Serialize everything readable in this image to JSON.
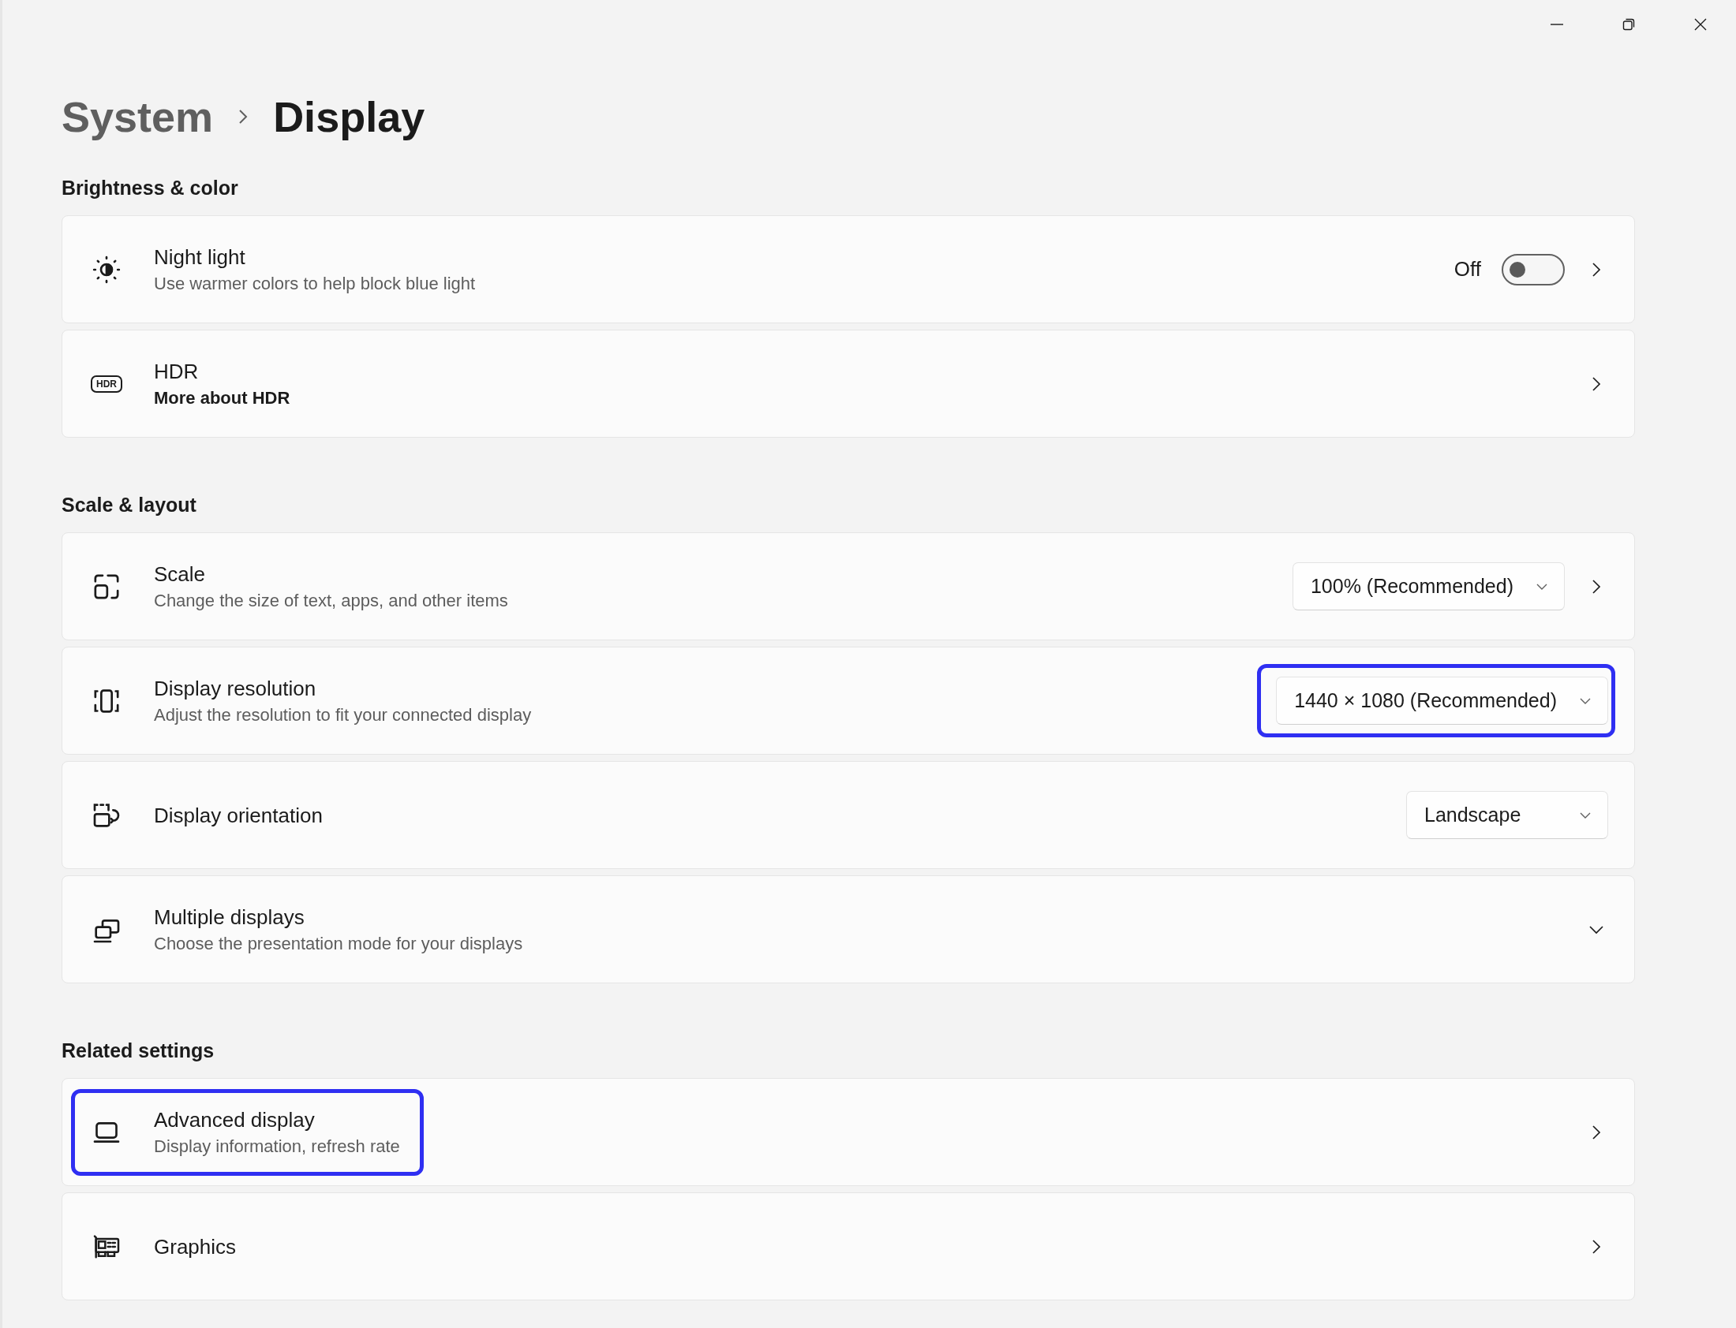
{
  "window": {
    "controls": [
      {
        "kind": "minimize"
      },
      {
        "kind": "restore"
      },
      {
        "kind": "close"
      }
    ]
  },
  "breadcrumb": {
    "parent": "System",
    "current": "Display"
  },
  "sections": [
    {
      "title": "Brightness & color",
      "items": [
        {
          "title": "Night light",
          "subtitle": "Use warmer colors to help block blue light",
          "control": {
            "kind": "toggle",
            "on": false,
            "state_label": "Off"
          },
          "kind": "navigation",
          "highlighted": false
        },
        {
          "title": "HDR",
          "badge": "HDR",
          "link": "More about HDR",
          "kind": "navigation",
          "highlighted": false
        }
      ]
    },
    {
      "title": "Scale & layout",
      "items": [
        {
          "title": "Scale",
          "subtitle": "Change the size of text, apps, and other items",
          "control": {
            "kind": "dropdown",
            "value": "100% (Recommended)"
          },
          "kind": "navigation",
          "highlighted": false
        },
        {
          "title": "Display resolution",
          "subtitle": "Adjust the resolution to fit your connected display",
          "control": {
            "kind": "dropdown",
            "value": "1440 × 1080 (Recommended)"
          },
          "kind": "static",
          "highlighted": true
        },
        {
          "title": "Display orientation",
          "control": {
            "kind": "dropdown",
            "value": "Landscape"
          },
          "kind": "static",
          "highlighted": false
        },
        {
          "title": "Multiple displays",
          "subtitle": "Choose the presentation mode for your displays",
          "kind": "expander",
          "expanded": false,
          "highlighted": false
        }
      ]
    },
    {
      "title": "Related settings",
      "items": [
        {
          "title": "Advanced display",
          "subtitle": "Display information, refresh rate",
          "kind": "navigation",
          "highlighted": true
        },
        {
          "title": "Graphics",
          "kind": "navigation",
          "highlighted": false
        }
      ]
    }
  ]
}
